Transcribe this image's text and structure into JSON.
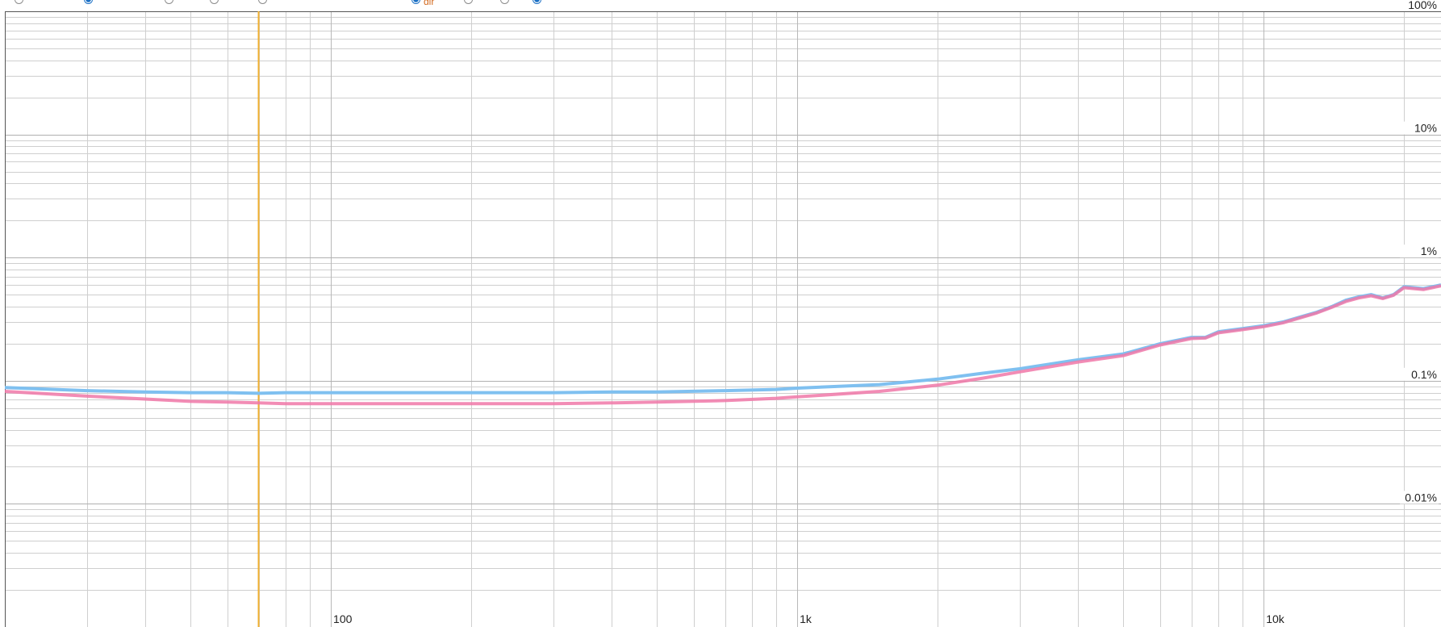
{
  "toolbar": {
    "radios": [
      {
        "name": "radio-1",
        "checked": false
      },
      {
        "name": "radio-2",
        "checked": true
      },
      {
        "name": "radio-3",
        "checked": false
      },
      {
        "name": "radio-4",
        "checked": false
      },
      {
        "name": "radio-5",
        "checked": false
      },
      {
        "name": "radio-6",
        "checked": true
      },
      {
        "name": "radio-7",
        "checked": false
      },
      {
        "name": "radio-8",
        "checked": false
      },
      {
        "name": "radio-9",
        "checked": true
      }
    ],
    "partial_label": "dir"
  },
  "chart_data": {
    "type": "line",
    "title": "",
    "xlabel": "",
    "ylabel": "",
    "x_scale": "log",
    "y_scale": "log",
    "xlim": [
      20,
      24000
    ],
    "ylim": [
      0.001,
      100
    ],
    "grid": true,
    "x_tick_labels": [
      {
        "value": 100,
        "label": "100"
      },
      {
        "value": 1000,
        "label": "1k"
      },
      {
        "value": 10000,
        "label": "10k"
      }
    ],
    "y_tick_labels": [
      {
        "value": 100,
        "label": "100%"
      },
      {
        "value": 10,
        "label": "10%"
      },
      {
        "value": 1,
        "label": "1%"
      },
      {
        "value": 0.1,
        "label": "0.1%"
      },
      {
        "value": 0.01,
        "label": "0.01%"
      }
    ],
    "marker_line": {
      "x": 70,
      "color": "#f0b030"
    },
    "series": [
      {
        "color": "#7fc0f0",
        "x": [
          20,
          30,
          40,
          50,
          60,
          70,
          80,
          100,
          150,
          200,
          300,
          400,
          500,
          700,
          900,
          1000,
          1500,
          2000,
          2500,
          3000,
          4000,
          5000,
          6000,
          7000,
          7500,
          8000,
          9000,
          10000,
          11000,
          12000,
          13000,
          14000,
          15000,
          16000,
          17000,
          18000,
          19000,
          20000,
          22000,
          24000
        ],
        "y": [
          0.088,
          0.083,
          0.081,
          0.08,
          0.08,
          0.079,
          0.08,
          0.08,
          0.08,
          0.08,
          0.08,
          0.081,
          0.081,
          0.083,
          0.085,
          0.087,
          0.093,
          0.103,
          0.115,
          0.125,
          0.148,
          0.165,
          0.2,
          0.225,
          0.225,
          0.25,
          0.265,
          0.28,
          0.3,
          0.33,
          0.36,
          0.4,
          0.45,
          0.48,
          0.5,
          0.47,
          0.5,
          0.58,
          0.56,
          0.6
        ]
      },
      {
        "color": "#f078a8",
        "x": [
          20,
          30,
          40,
          50,
          60,
          70,
          80,
          100,
          150,
          200,
          300,
          400,
          500,
          700,
          900,
          1000,
          1500,
          2000,
          2500,
          3000,
          4000,
          5000,
          6000,
          7000,
          7500,
          8000,
          9000,
          10000,
          11000,
          12000,
          13000,
          14000,
          15000,
          16000,
          17000,
          18000,
          19000,
          20000,
          22000,
          24000
        ],
        "y": [
          0.082,
          0.075,
          0.071,
          0.068,
          0.067,
          0.066,
          0.065,
          0.065,
          0.065,
          0.065,
          0.065,
          0.066,
          0.067,
          0.069,
          0.072,
          0.074,
          0.082,
          0.092,
          0.105,
          0.118,
          0.142,
          0.16,
          0.195,
          0.22,
          0.222,
          0.245,
          0.26,
          0.275,
          0.295,
          0.325,
          0.355,
          0.395,
          0.44,
          0.47,
          0.49,
          0.465,
          0.495,
          0.57,
          0.55,
          0.59
        ]
      }
    ]
  }
}
